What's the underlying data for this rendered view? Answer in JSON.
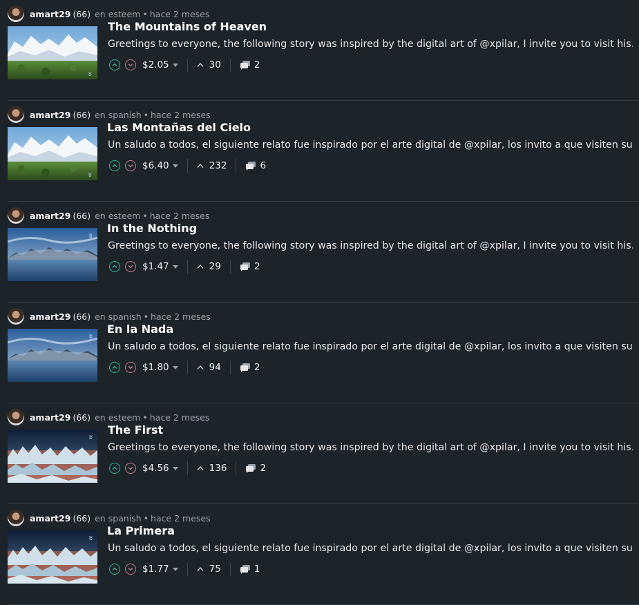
{
  "posts": [
    {
      "author": "amart29",
      "reputation": "(66)",
      "community": "en esteem",
      "separator": "•",
      "time": "hace 2 meses",
      "title": "The Mountains of Heaven",
      "summary": "Greetings to everyone, the following story was inspired by the digital art of @xpilar, I invite you to visit his…",
      "payout": "$2.05",
      "votes": "30",
      "comments": "2",
      "thumb": "snow"
    },
    {
      "author": "amart29",
      "reputation": "(66)",
      "community": "en spanish",
      "separator": "•",
      "time": "hace 2 meses",
      "title": "Las Montañas del Cielo",
      "summary": "Un saludo a todos, el siguiente relato fue inspirado por el arte digital de @xpilar, los invito a que visiten su blog.…",
      "payout": "$6.40",
      "votes": "232",
      "comments": "6",
      "thumb": "snow"
    },
    {
      "author": "amart29",
      "reputation": "(66)",
      "community": "en esteem",
      "separator": "•",
      "time": "hace 2 meses",
      "title": "In the Nothing",
      "summary": "Greetings to everyone, the following story was inspired by the digital art of @xpilar, I invite you to visit his…",
      "payout": "$1.47",
      "votes": "29",
      "comments": "2",
      "thumb": "sea"
    },
    {
      "author": "amart29",
      "reputation": "(66)",
      "community": "en spanish",
      "separator": "•",
      "time": "hace 2 meses",
      "title": "En la Nada",
      "summary": "Un saludo a todos, el siguiente relato fue inspirado por el arte digital de @xpilar, los invito a que visiten su blog.…",
      "payout": "$1.80",
      "votes": "94",
      "comments": "2",
      "thumb": "sea"
    },
    {
      "author": "amart29",
      "reputation": "(66)",
      "community": "en esteem",
      "separator": "•",
      "time": "hace 2 meses",
      "title": "The First",
      "summary": "Greetings to everyone, the following story was inspired by the digital art of @xpilar, I invite you to visit his…",
      "payout": "$4.56",
      "votes": "136",
      "comments": "2",
      "thumb": "ice"
    },
    {
      "author": "amart29",
      "reputation": "(66)",
      "community": "en spanish",
      "separator": "•",
      "time": "hace 2 meses",
      "title": "La Primera",
      "summary": "Un saludo a todos, el siguiente relato fue inspirado por el arte digital de @xpilar, los invito a que visiten su blog.…",
      "payout": "$1.77",
      "votes": "75",
      "comments": "1",
      "thumb": "ice"
    }
  ],
  "colors": {
    "background": "#1c2329",
    "upvote": "#2ab99a",
    "downvote": "#c87a82",
    "muted": "#9aa3ab"
  },
  "icons": {
    "upvote": "chevron-up-circle-icon",
    "downvote": "chevron-down-circle-icon",
    "payout_menu": "caret-down-icon",
    "votes": "chevron-up-icon",
    "comments": "comments-icon"
  }
}
